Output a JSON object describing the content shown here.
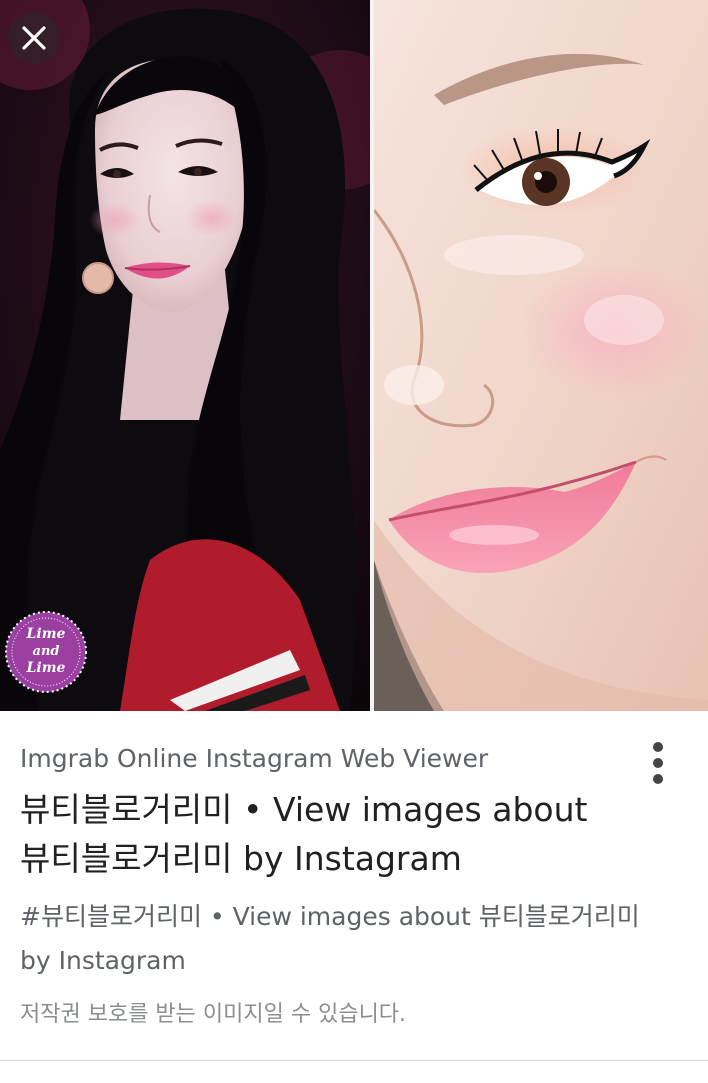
{
  "viewer": {
    "close_label": "close"
  },
  "images": {
    "left": {
      "watermark": {
        "line1": "Lime",
        "line2": "and",
        "line3": "Lime"
      }
    }
  },
  "result": {
    "source": "Imgrab Online Instagram Web Viewer",
    "title_line1": "뷰티블로거리미 • View images about",
    "title_line2": "뷰티블로거리미 by Instagram",
    "description_line1": "#뷰티블로거리미 • View images about 뷰티블로거리미",
    "description_line2": "by Instagram",
    "copyright_notice": "저작권 보호를 받는 이미지일 수 있습니다."
  },
  "colors": {
    "source_text": "#5f6368",
    "title_text": "#202124",
    "notice_text": "#8a8d91",
    "watermark_purple": "#9b3fa1"
  },
  "icons": {
    "close": "close-icon",
    "more": "more-vert-icon"
  }
}
